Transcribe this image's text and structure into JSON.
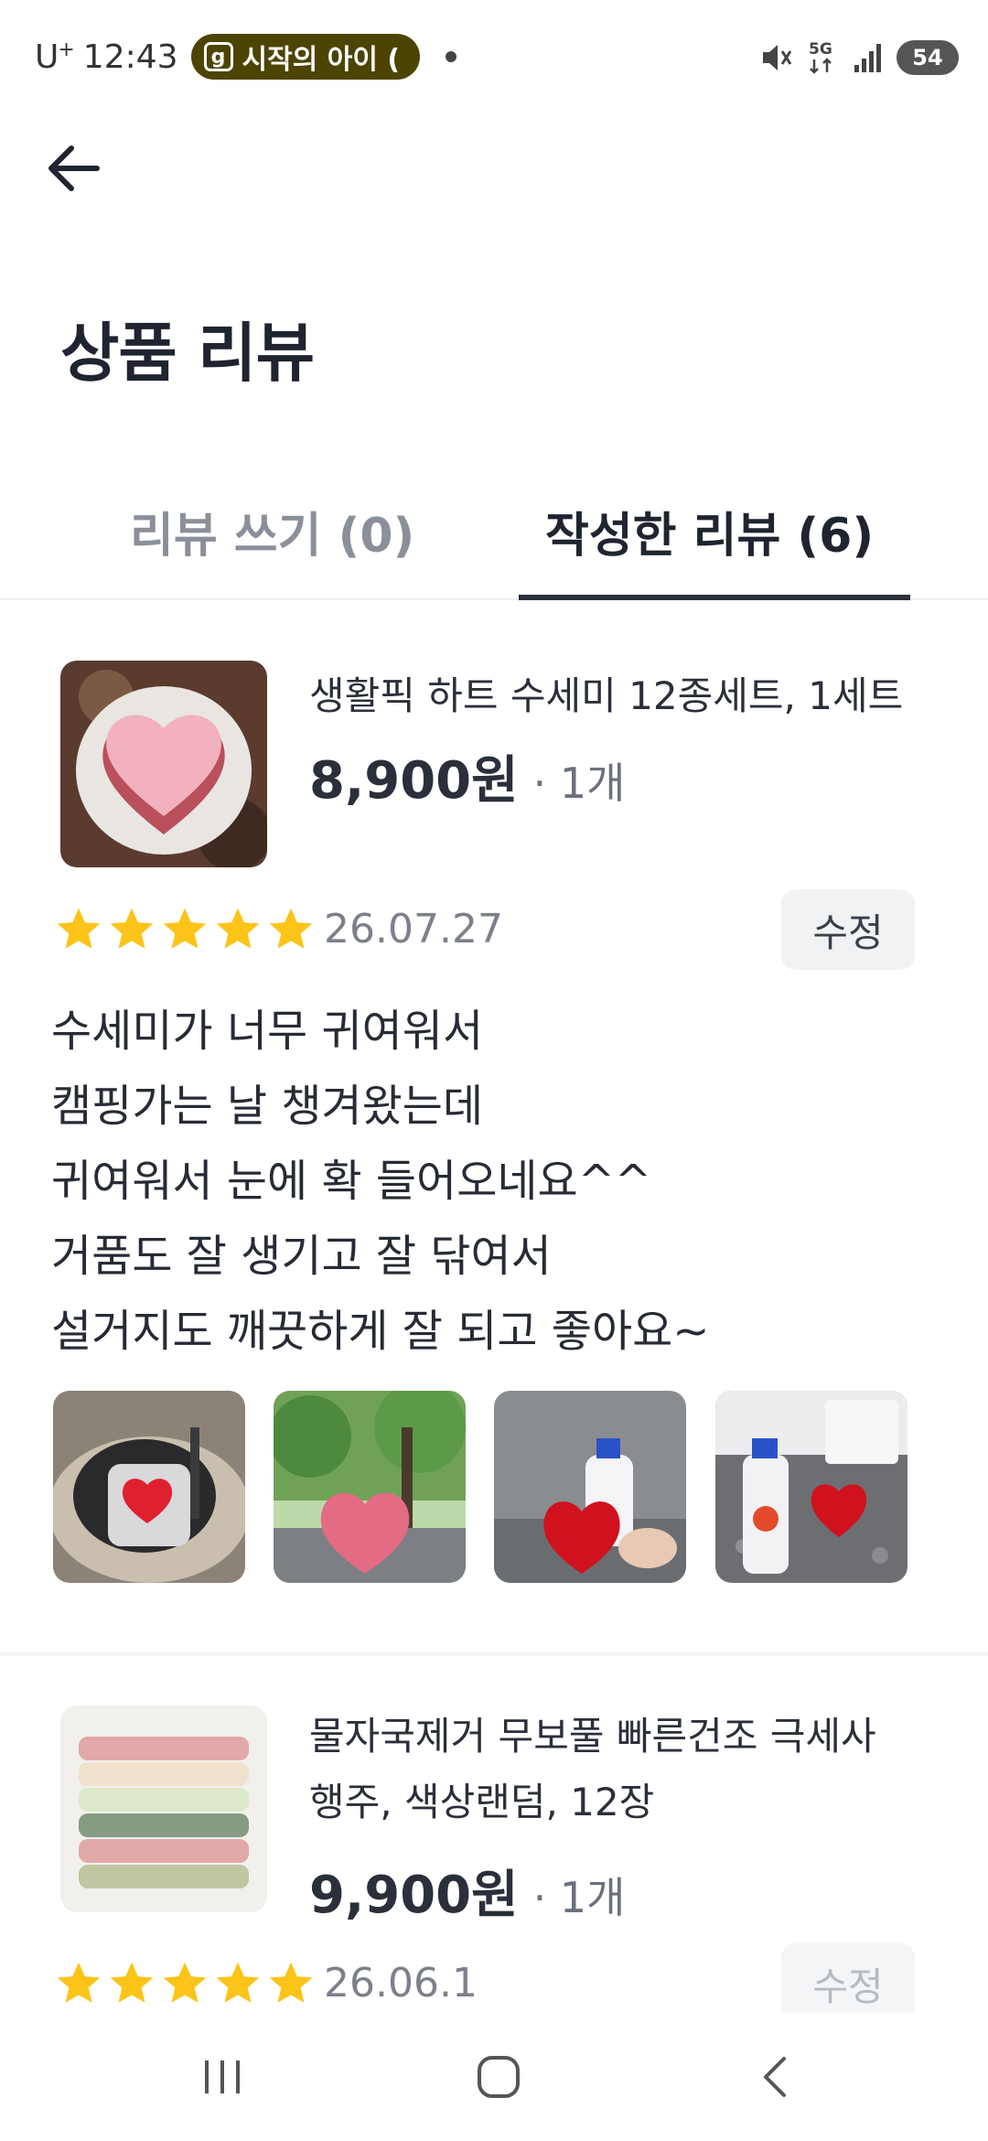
{
  "status_bar": {
    "carrier": "U",
    "carrier_sup": "+",
    "time": "12:43",
    "app_badge_icon": "g",
    "app_badge_text": "시작의 아이 (",
    "battery": "54",
    "icons": [
      "mute-icon",
      "5g-icon",
      "signal-icon",
      "battery-icon"
    ]
  },
  "header": {
    "back_icon": "arrow-left-icon",
    "title": "상품 리뷰"
  },
  "tabs": [
    {
      "label": "리뷰 쓰기 (0)",
      "active": false
    },
    {
      "label": "작성한 리뷰 (6)",
      "active": true
    }
  ],
  "reviews": [
    {
      "product_name": "생활픽 하트 수세미 12종세트, 1세트",
      "price": "8,900원",
      "qty": "· 1개",
      "rating": 5,
      "date": "26.07.27",
      "edit_label": "수정",
      "text": "수세미가 너무 귀여워서\n캠핑가는 날 챙겨왔는데\n귀여워서 눈에 확 들어오네요^^\n거품도 잘 생기고 잘 닦여서\n설거지도 깨끗하게 잘 되고 좋아요~",
      "photo_count": 4
    },
    {
      "product_name": "물자국제거 무보풀 빠른건조 극세사 행주, 색상랜덤, 12장",
      "price": "9,900원",
      "qty": "· 1개",
      "rating": 5,
      "date": "26.06.1",
      "edit_label": "수정"
    }
  ],
  "colors": {
    "star": "#fcc419",
    "badge_bg": "#4d4403",
    "tab_underline": "#2b3039"
  },
  "nav": [
    "recent-apps-icon",
    "home-icon",
    "back-icon"
  ]
}
